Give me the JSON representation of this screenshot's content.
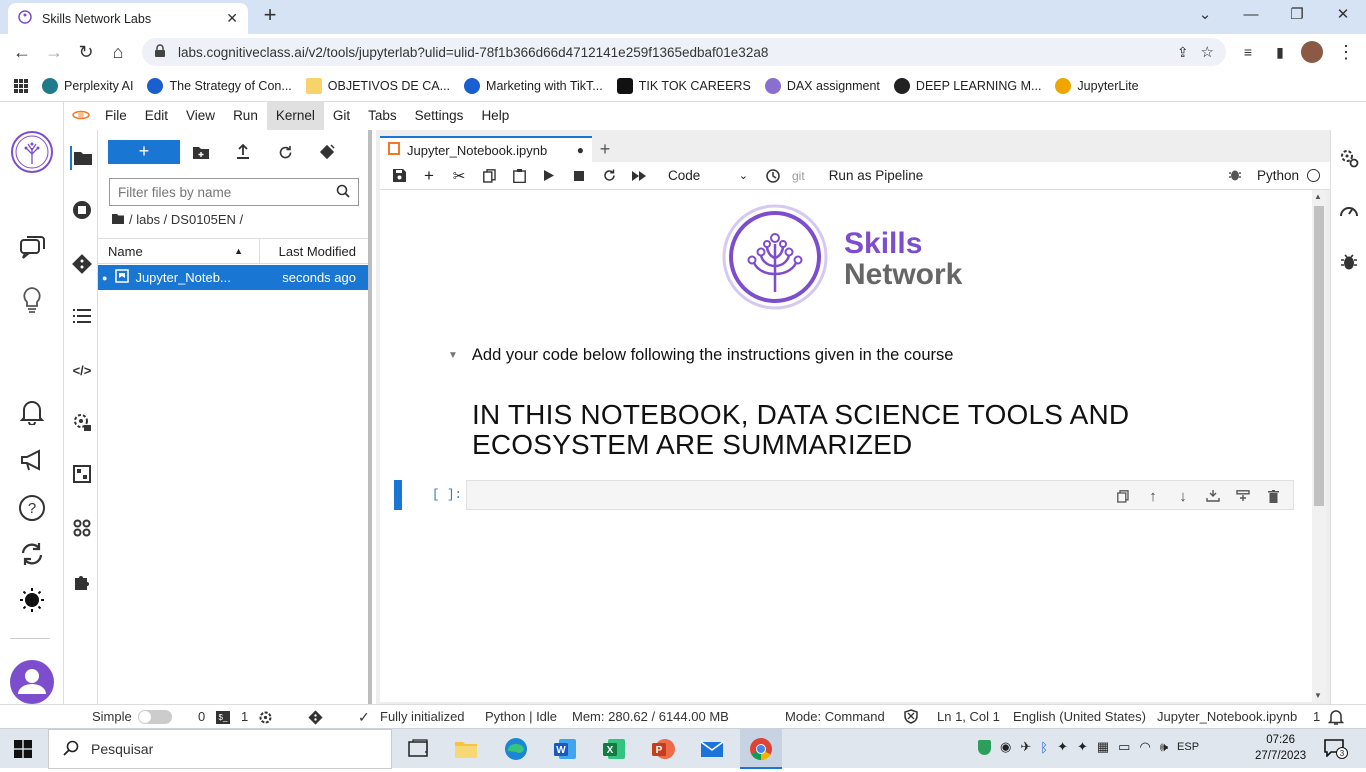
{
  "browser": {
    "tab_title": "Skills Network Labs",
    "url": "labs.cognitiveclass.ai/v2/tools/jupyterlab?ulid=ulid-78f1b366d66d4712141e259f1365edbaf01e32a8",
    "bookmarks": [
      {
        "label": "Perplexity AI",
        "color": "#1f7a8c"
      },
      {
        "label": "The Strategy of Con...",
        "color": "#1a5fd0"
      },
      {
        "label": "OBJETIVOS DE CA...",
        "color": "#f7d36b"
      },
      {
        "label": "Marketing with TikT...",
        "color": "#1a5fd0"
      },
      {
        "label": "TIK TOK CAREERS",
        "color": "#111111"
      },
      {
        "label": "DAX assignment",
        "color": "#8a6fd1"
      },
      {
        "label": "DEEP LEARNING M...",
        "color": "#222222"
      },
      {
        "label": "JupyterLite",
        "color": "#f0a500"
      }
    ]
  },
  "menubar": [
    "File",
    "Edit",
    "View",
    "Run",
    "Kernel",
    "Git",
    "Tabs",
    "Settings",
    "Help"
  ],
  "menubar_active": "Kernel",
  "filebrowser": {
    "new_label": "+",
    "filter_placeholder": "Filter files by name",
    "breadcrumb": "/ labs / DS0105EN /",
    "col_name": "Name",
    "col_modified": "Last Modified",
    "files": [
      {
        "name": "Jupyter_Noteb...",
        "modified": "seconds ago"
      }
    ]
  },
  "notebook": {
    "tab_title": "Jupyter_Notebook.ipynb",
    "cell_type": "Code",
    "git_label": "git",
    "pipeline_label": "Run as Pipeline",
    "kernel": "Python",
    "logo_line1": "Skills",
    "logo_line2": "Network",
    "subheading": "Add your code below following the instructions given in the course",
    "heading": "IN THIS NOTEBOOK, DATA SCIENCE TOOLS AND ECOSYSTEM ARE SUMMARIZED",
    "prompt": "[ ]:"
  },
  "statusbar": {
    "mode_label": "Simple",
    "terminals": "0",
    "kernels": "1",
    "init": "Fully initialized",
    "kernel_state": "Python | Idle",
    "mem": "Mem: 280.62 / 6144.00 MB",
    "mode": "Mode: Command",
    "cursor": "Ln 1, Col 1",
    "language": "English (United States)",
    "file": "Jupyter_Notebook.ipynb",
    "notif_count": "1"
  },
  "taskbar": {
    "search_placeholder": "Pesquisar",
    "lang": "ESP",
    "time": "07:26",
    "date": "27/7/2023",
    "notif": "3"
  },
  "colors": {
    "accent": "#1976d2",
    "brand": "#7c4dcc",
    "tabbar": "#d5e3f5"
  }
}
